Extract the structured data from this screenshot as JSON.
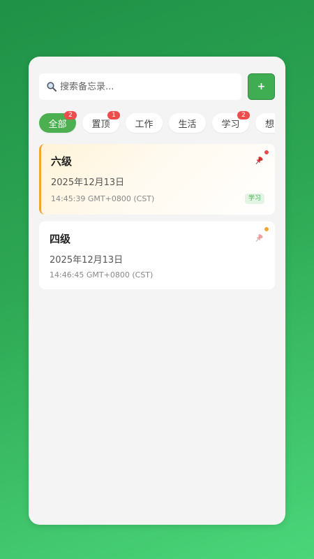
{
  "search": {
    "placeholder": "搜索备忘录..."
  },
  "toolbar": {
    "add_label": "+"
  },
  "filters": [
    {
      "label": "全部",
      "badge": "2",
      "active": true
    },
    {
      "label": "置顶",
      "badge": "1",
      "active": false
    },
    {
      "label": "工作",
      "badge": "",
      "active": false
    },
    {
      "label": "生活",
      "badge": "",
      "active": false
    },
    {
      "label": "学习",
      "badge": "2",
      "active": false
    },
    {
      "label": "想",
      "badge": "",
      "active": false
    }
  ],
  "notes": [
    {
      "title": "六级",
      "date": "2025年12月13日",
      "time": "14:45:39 GMT+0800 (CST)",
      "tag": "学习",
      "pinned": true,
      "dot_color": "#e84b4b"
    },
    {
      "title": "四级",
      "date": "2025年12月13日",
      "time": "14:46:45 GMT+0800 (CST)",
      "tag": "",
      "pinned": false,
      "dot_color": "#f3a531"
    }
  ],
  "colors": {
    "accent": "#4caf50",
    "badge": "#ef4c4c",
    "pinned_border": "#f3a531"
  }
}
